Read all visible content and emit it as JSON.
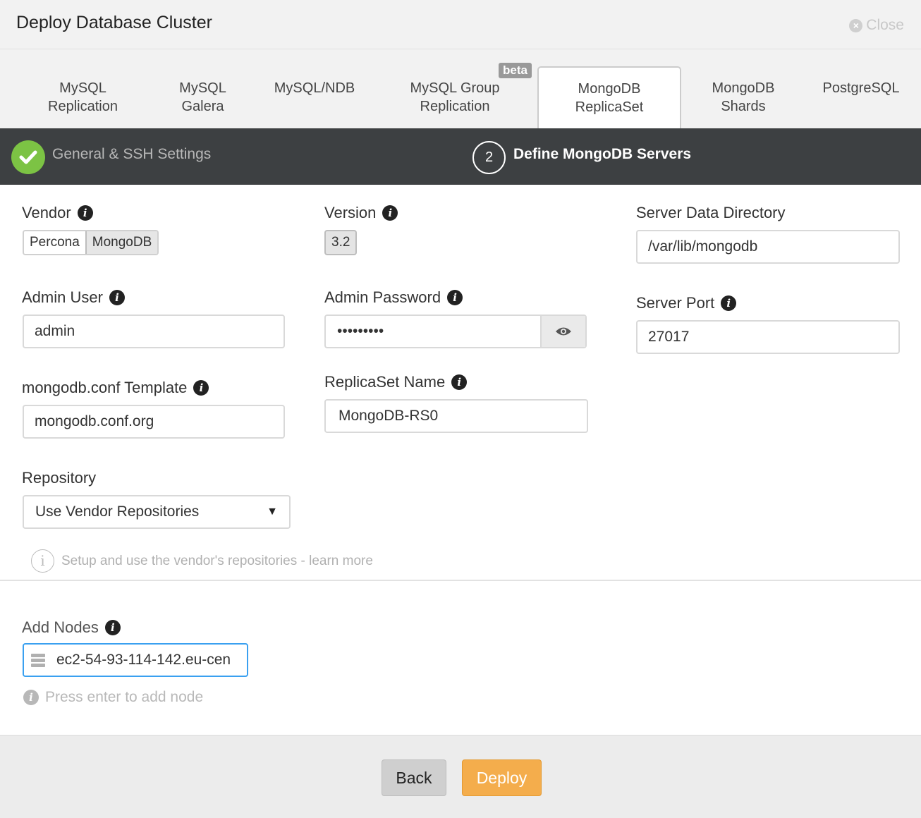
{
  "dialog": {
    "title": "Deploy Database Cluster",
    "close_label": "Close"
  },
  "tabs": [
    {
      "line1": "MySQL",
      "line2": "Replication"
    },
    {
      "line1": "MySQL",
      "line2": "Galera"
    },
    {
      "line1": "MySQL/NDB",
      "line2": ""
    },
    {
      "line1": "MySQL Group",
      "line2": "Replication"
    },
    {
      "line1": "MongoDB",
      "line2": "ReplicaSet"
    },
    {
      "line1": "MongoDB",
      "line2": "Shards"
    },
    {
      "line1": "PostgreSQL",
      "line2": ""
    }
  ],
  "beta_badge": "beta",
  "active_tab": "MongoDB ReplicaSet",
  "steps": {
    "step1_label": "General & SSH Settings",
    "step2_number": "2",
    "step2_label": "Define MongoDB Servers"
  },
  "form": {
    "vendor": {
      "label": "Vendor",
      "options": [
        "Percona",
        "MongoDB"
      ],
      "selected": "MongoDB"
    },
    "version": {
      "label": "Version",
      "value": "3.2"
    },
    "data_dir": {
      "label": "Server Data Directory",
      "value": "/var/lib/mongodb"
    },
    "admin_user": {
      "label": "Admin User",
      "value": "admin"
    },
    "admin_password": {
      "label": "Admin Password",
      "value": "•••••••••"
    },
    "server_port": {
      "label": "Server Port",
      "value": "27017"
    },
    "conf_template": {
      "label": "mongodb.conf Template",
      "value": "mongodb.conf.org"
    },
    "replicaset_name": {
      "label": "ReplicaSet Name",
      "value": "MongoDB-RS0"
    },
    "repository": {
      "label": "Repository",
      "value": "Use Vendor Repositories",
      "hint": "Setup and use the vendor's repositories - learn more"
    },
    "add_nodes": {
      "label": "Add Nodes",
      "value": "ec2-54-93-114-142.eu-cen",
      "hint": "Press enter to add node"
    }
  },
  "footer": {
    "back_label": "Back",
    "deploy_label": "Deploy"
  },
  "colors": {
    "accent_green": "#7cc344",
    "deploy_orange": "#f4ad4c",
    "step_bar": "#3d4042",
    "focus_blue": "#3aa0f0"
  }
}
